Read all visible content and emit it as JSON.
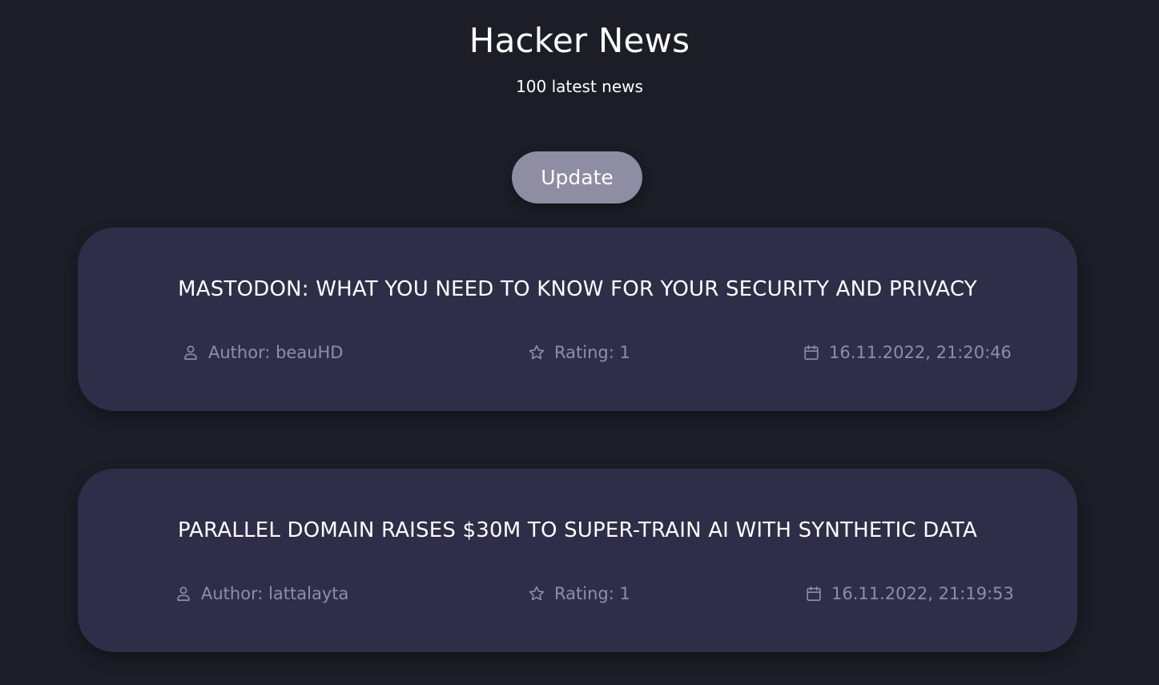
{
  "header": {
    "title": "Hacker News",
    "subtitle": "100 latest news"
  },
  "actions": {
    "update_label": "Update"
  },
  "news": [
    {
      "title": "MASTODON: WHAT YOU NEED TO KNOW FOR YOUR SECURITY AND PRIVACY",
      "author": "Author: beauHD",
      "rating": "Rating: 1",
      "date": "16.11.2022, 21:20:46"
    },
    {
      "title": "PARALLEL DOMAIN RAISES $30M TO SUPER-TRAIN AI WITH SYNTHETIC DATA",
      "author": "Author: lattalayta",
      "rating": "Rating: 1",
      "date": "16.11.2022, 21:19:53"
    }
  ],
  "icons": {
    "author": "user-icon",
    "rating": "star-icon",
    "date": "calendar-icon"
  },
  "colors": {
    "background": "#1d1d27",
    "card": "#2f2e48",
    "button": "#8e8da3",
    "meta_text": "#8f8ea6",
    "text": "#ffffff"
  }
}
